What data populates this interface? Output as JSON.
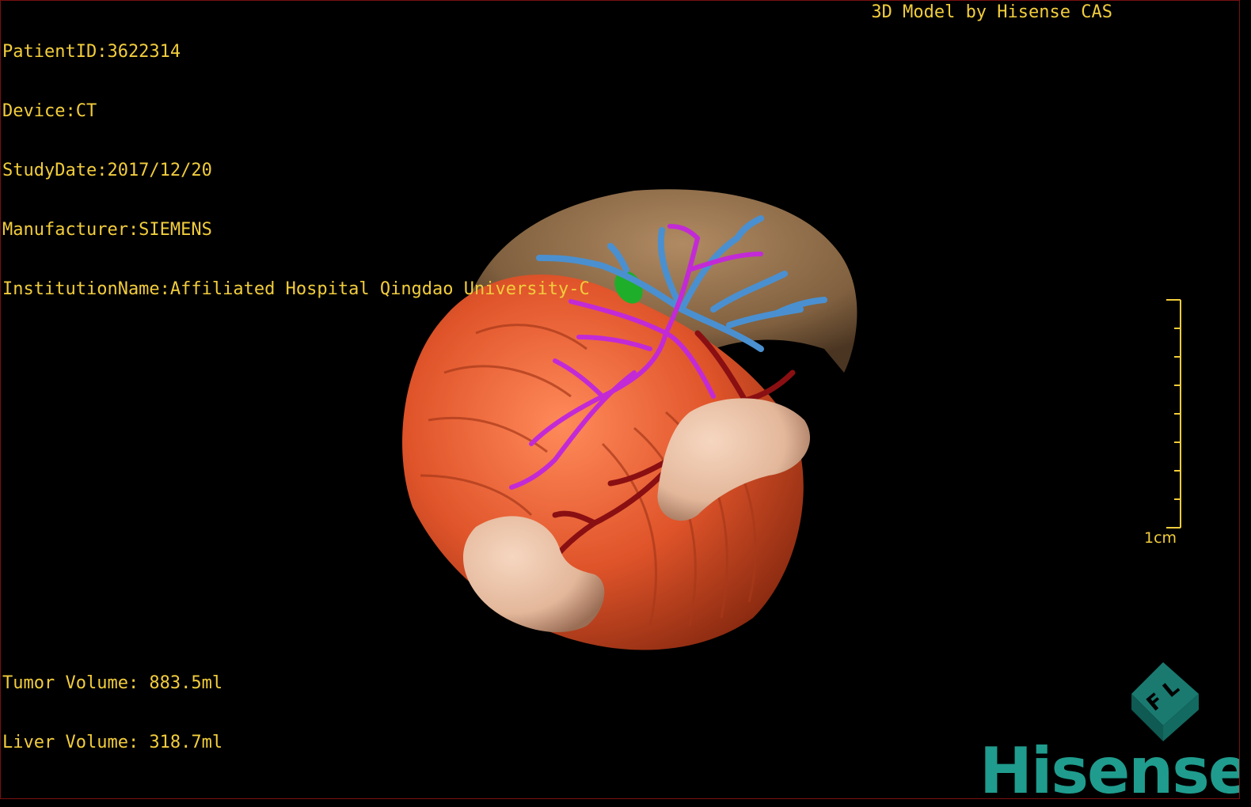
{
  "header": {
    "patient_id": "PatientID:3622314",
    "device": "Device:CT",
    "study_date": "StudyDate:2017/12/20",
    "manufacturer": "Manufacturer:SIEMENS",
    "institution": "InstitutionName:Affiliated Hospital Qingdao University-C",
    "brand_caption": "3D Model by Hisense CAS"
  },
  "footer": {
    "tumor_volume": "Tumor Volume: 883.5ml",
    "liver_volume": "Liver Volume: 318.7ml"
  },
  "scale_bar": {
    "label": "1cm"
  },
  "orientation_cube": {
    "face_letters": "F L"
  },
  "logo": {
    "text": "Hisense"
  },
  "colors": {
    "overlay_text": "#f2cd3c",
    "tumor": "#e0542a",
    "liver": "#8a6a48",
    "hepatic_vein": "#4a90d0",
    "portal_vein": "#c22ad6",
    "artery": "#8a0f12",
    "gallbladder": "#1fae2a",
    "kidney": "#e3b79a",
    "logo": "#1f9c8d"
  }
}
